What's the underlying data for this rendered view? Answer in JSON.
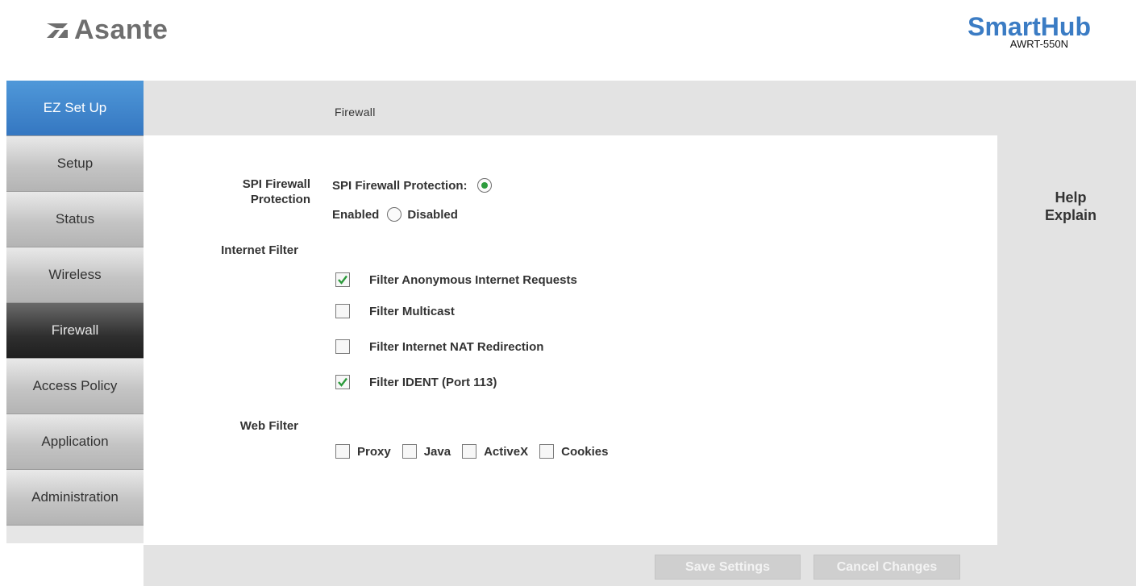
{
  "header": {
    "brand": "Asante",
    "product": "SmartHub",
    "model": "AWRT-550N",
    "brand_color": "#6e6e6e",
    "product_color": "#3b7cc4"
  },
  "sidebar": {
    "items": [
      {
        "label": "EZ Set Up",
        "state": "highlight"
      },
      {
        "label": "Setup"
      },
      {
        "label": "Status"
      },
      {
        "label": "Wireless"
      },
      {
        "label": "Firewall",
        "state": "current"
      },
      {
        "label": "Access Policy"
      },
      {
        "label": "Application"
      },
      {
        "label": "Administration"
      }
    ]
  },
  "page": {
    "title": "Firewall"
  },
  "spi": {
    "section_label_line1": "SPI Firewall",
    "section_label_line2": "Protection",
    "field_label": "SPI Firewall Protection:",
    "enabled_label": "Enabled",
    "disabled_label": "Disabled",
    "selected": "Enabled"
  },
  "internet_filter": {
    "section_label": "Internet Filter",
    "options": [
      {
        "label": "Filter Anonymous Internet Requests",
        "checked": true
      },
      {
        "label": "Filter Multicast",
        "checked": false
      },
      {
        "label": "Filter Internet NAT Redirection",
        "checked": false
      },
      {
        "label": "Filter IDENT (Port 113)",
        "checked": true
      }
    ]
  },
  "web_filter": {
    "section_label": "Web Filter",
    "options": [
      {
        "label": "Proxy",
        "checked": false
      },
      {
        "label": "Java",
        "checked": false
      },
      {
        "label": "ActiveX",
        "checked": false
      },
      {
        "label": "Cookies",
        "checked": false
      }
    ]
  },
  "help": {
    "line1": "Help",
    "line2": "Explain"
  },
  "buttons": {
    "save": "Save Settings",
    "cancel": "Cancel Changes"
  },
  "colors": {
    "checkmark": "#2b9a3b",
    "nav_highlight": "#3577c1"
  }
}
